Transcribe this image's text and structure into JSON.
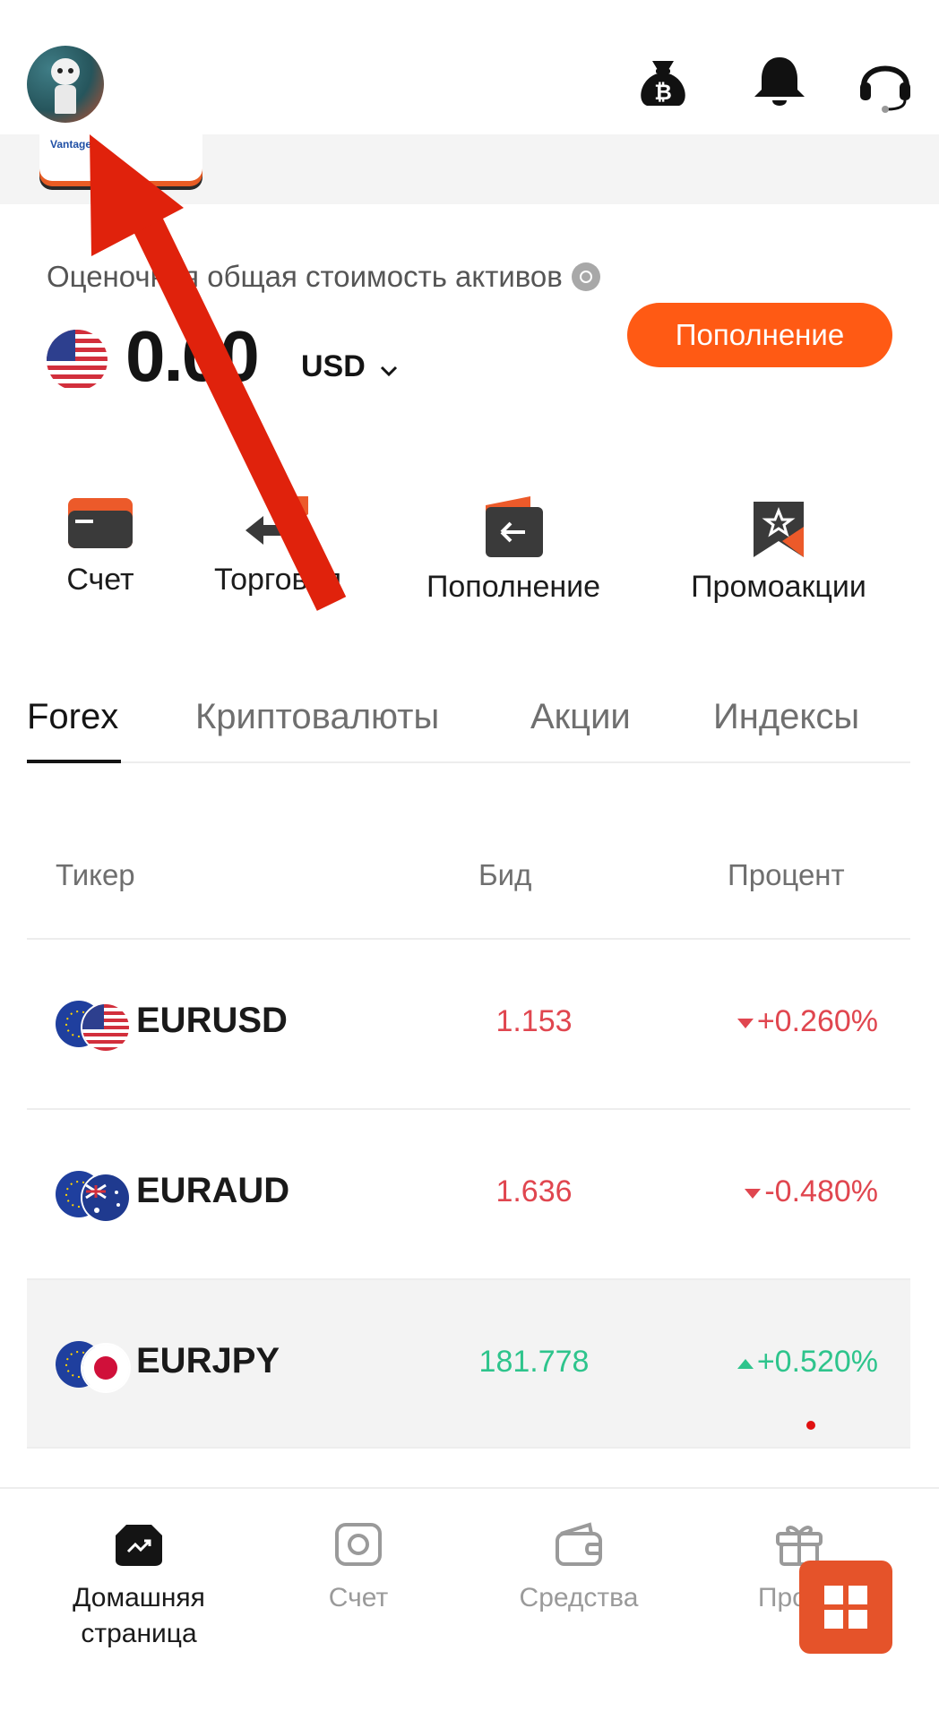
{
  "header": {
    "avatar_alt": "user avatar",
    "icons": [
      "bitcoin-bag-icon",
      "bell-icon",
      "headset-icon"
    ]
  },
  "banner": {
    "card_text": "Vantage"
  },
  "balance": {
    "label": "Оценочная общая стоимость активов",
    "amount": "0.00",
    "currency": "USD",
    "deposit_button": "Пополнение"
  },
  "quick_actions": [
    {
      "label": "Счет",
      "icon": "wallet-icon"
    },
    {
      "label": "Торговля",
      "icon": "trade-arrows-icon"
    },
    {
      "label": "Пополнение",
      "icon": "deposit-icon"
    },
    {
      "label": "Промоакции",
      "icon": "promo-star-icon"
    }
  ],
  "tabs": [
    {
      "label": "Forex",
      "active": true
    },
    {
      "label": "Криптовалюты",
      "active": false
    },
    {
      "label": "Акции",
      "active": false
    },
    {
      "label": "Индексы",
      "active": false
    }
  ],
  "table": {
    "headers": {
      "ticker": "Тикер",
      "bid": "Бид",
      "percent": "Процент"
    },
    "rows": [
      {
        "ticker": "EURUSD",
        "bid": "1.153",
        "percent": "+0.260%",
        "bid_color": "red",
        "direction": "down"
      },
      {
        "ticker": "EURAUD",
        "bid": "1.636",
        "percent": "-0.480%",
        "bid_color": "red",
        "direction": "down"
      },
      {
        "ticker": "EURJPY",
        "bid": "181.778",
        "percent": "+0.520%",
        "bid_color": "green",
        "direction": "up"
      }
    ]
  },
  "bottom_nav": [
    {
      "label": "Домашняя страница",
      "active": true
    },
    {
      "label": "Счет",
      "active": false
    },
    {
      "label": "Средства",
      "active": false
    },
    {
      "label": "Промо",
      "active": false
    }
  ],
  "colors": {
    "accent": "#ff5a14",
    "down": "#e0464f",
    "up": "#2ec48c",
    "annotation_arrow": "#e0220c"
  }
}
